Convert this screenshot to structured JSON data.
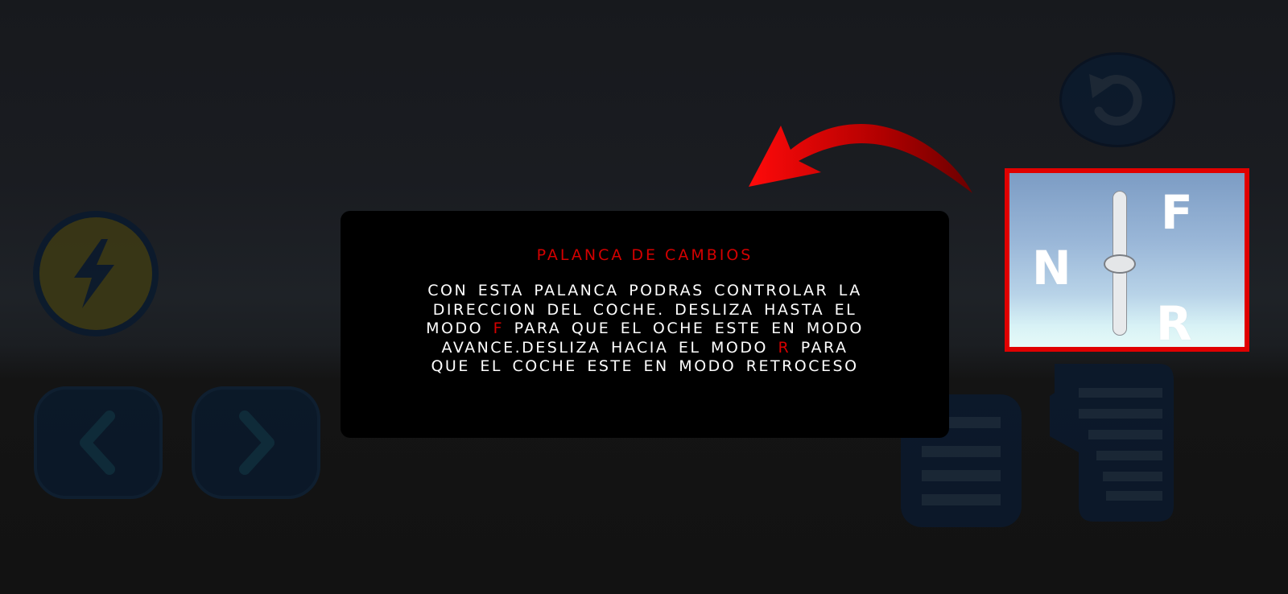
{
  "tutorial": {
    "title": "PALANCA DE CAMBIOS",
    "line1": "CON ESTA PALANCA PODRAS CONTROLAR LA",
    "line2": "DIRECCION DEL COCHE. DESLIZA HASTA EL",
    "line3_pre": "MODO ",
    "line3_key": "F",
    "line3_post": " PARA QUE EL OCHE ESTE EN MODO",
    "line4_pre": "AVANCE.DESLIZA HACIA EL MODO ",
    "line4_key": "R",
    "line4_post": " PARA",
    "line5": "QUE EL COCHE ESTE EN MODO RETROCESO"
  },
  "gear_shifter": {
    "forward_label": "F",
    "neutral_label": "N",
    "reverse_label": "R",
    "current_gear": "N"
  },
  "controls": {
    "boost_icon": "lightning-bolt-icon",
    "left_icon": "chevron-left-icon",
    "right_icon": "chevron-right-icon",
    "reset_icon": "rotate-ccw-icon",
    "brake_icon": "brake-pedal-icon",
    "gas_icon": "gas-pedal-icon"
  },
  "colors": {
    "highlight": "#e00000",
    "accent_text": "#d40000",
    "panel": "#000000",
    "control_fill": "#0a1a2c"
  }
}
